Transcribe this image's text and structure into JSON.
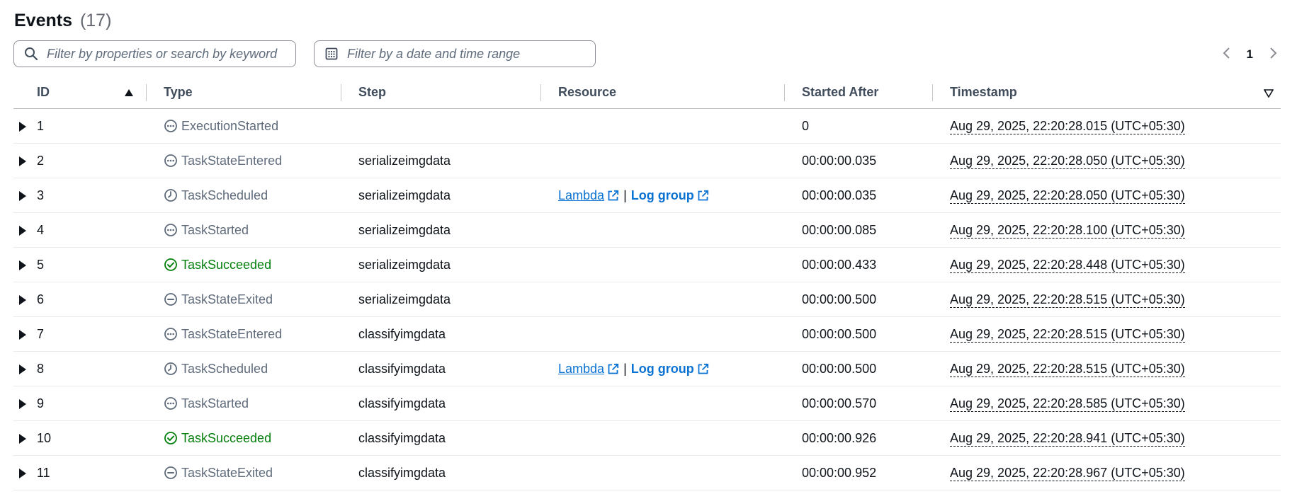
{
  "header": {
    "title": "Events",
    "count": "(17)"
  },
  "filters": {
    "search_placeholder": "Filter by properties or search by keyword",
    "date_placeholder": "Filter by a date and time range"
  },
  "pagination": {
    "current_page": "1"
  },
  "columns": {
    "id": "ID",
    "type": "Type",
    "step": "Step",
    "resource": "Resource",
    "started_after": "Started After",
    "timestamp": "Timestamp"
  },
  "resource_links": {
    "lambda": "Lambda",
    "separator": "|",
    "log_group": "Log group"
  },
  "colors": {
    "success": "#037f0c",
    "link": "#0972d3",
    "neutral": "#5f6b7a"
  },
  "rows": [
    {
      "id": "1",
      "type": "ExecutionStarted",
      "icon": "ellipsis-circle-icon",
      "status": "neutral",
      "step": "",
      "resource": false,
      "started_after": "0",
      "timestamp": "Aug 29, 2025, 22:20:28.015 (UTC+05:30)"
    },
    {
      "id": "2",
      "type": "TaskStateEntered",
      "icon": "ellipsis-circle-icon",
      "status": "neutral",
      "step": "serializeimgdata",
      "resource": false,
      "started_after": "00:00:00.035",
      "timestamp": "Aug 29, 2025, 22:20:28.050 (UTC+05:30)"
    },
    {
      "id": "3",
      "type": "TaskScheduled",
      "icon": "clock-icon",
      "status": "neutral",
      "step": "serializeimgdata",
      "resource": true,
      "started_after": "00:00:00.035",
      "timestamp": "Aug 29, 2025, 22:20:28.050 (UTC+05:30)"
    },
    {
      "id": "4",
      "type": "TaskStarted",
      "icon": "ellipsis-circle-icon",
      "status": "neutral",
      "step": "serializeimgdata",
      "resource": false,
      "started_after": "00:00:00.085",
      "timestamp": "Aug 29, 2025, 22:20:28.100 (UTC+05:30)"
    },
    {
      "id": "5",
      "type": "TaskSucceeded",
      "icon": "check-circle-icon",
      "status": "success",
      "step": "serializeimgdata",
      "resource": false,
      "started_after": "00:00:00.433",
      "timestamp": "Aug 29, 2025, 22:20:28.448 (UTC+05:30)"
    },
    {
      "id": "6",
      "type": "TaskStateExited",
      "icon": "minus-circle-icon",
      "status": "neutral",
      "step": "serializeimgdata",
      "resource": false,
      "started_after": "00:00:00.500",
      "timestamp": "Aug 29, 2025, 22:20:28.515 (UTC+05:30)"
    },
    {
      "id": "7",
      "type": "TaskStateEntered",
      "icon": "ellipsis-circle-icon",
      "status": "neutral",
      "step": "classifyimgdata",
      "resource": false,
      "started_after": "00:00:00.500",
      "timestamp": "Aug 29, 2025, 22:20:28.515 (UTC+05:30)"
    },
    {
      "id": "8",
      "type": "TaskScheduled",
      "icon": "clock-icon",
      "status": "neutral",
      "step": "classifyimgdata",
      "resource": true,
      "started_after": "00:00:00.500",
      "timestamp": "Aug 29, 2025, 22:20:28.515 (UTC+05:30)"
    },
    {
      "id": "9",
      "type": "TaskStarted",
      "icon": "ellipsis-circle-icon",
      "status": "neutral",
      "step": "classifyimgdata",
      "resource": false,
      "started_after": "00:00:00.570",
      "timestamp": "Aug 29, 2025, 22:20:28.585 (UTC+05:30)"
    },
    {
      "id": "10",
      "type": "TaskSucceeded",
      "icon": "check-circle-icon",
      "status": "success",
      "step": "classifyimgdata",
      "resource": false,
      "started_after": "00:00:00.926",
      "timestamp": "Aug 29, 2025, 22:20:28.941 (UTC+05:30)"
    },
    {
      "id": "11",
      "type": "TaskStateExited",
      "icon": "minus-circle-icon",
      "status": "neutral",
      "step": "classifyimgdata",
      "resource": false,
      "started_after": "00:00:00.952",
      "timestamp": "Aug 29, 2025, 22:20:28.967 (UTC+05:30)"
    }
  ]
}
